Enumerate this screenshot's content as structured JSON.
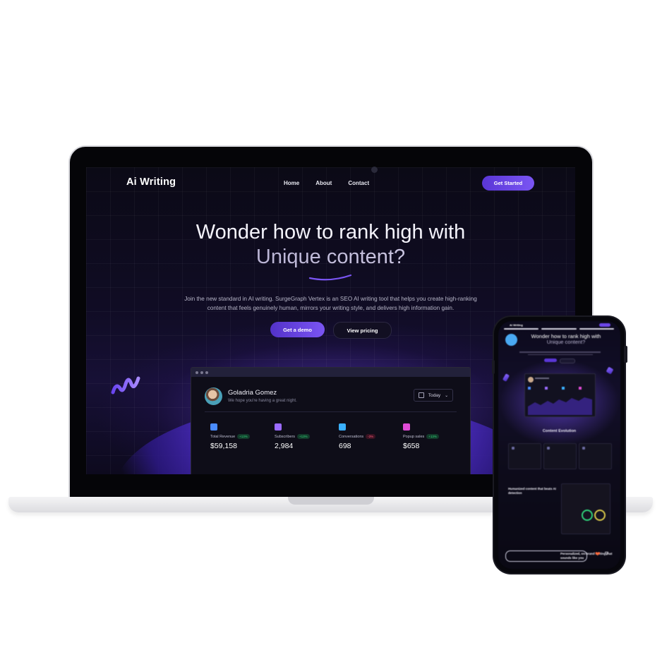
{
  "laptop": {
    "brand": "Ai Writing",
    "nav": [
      "Home",
      "About",
      "Contact"
    ],
    "cta_label": "Get Started",
    "headline_line1": "Wonder how to rank high with",
    "headline_line2": "Unique content?",
    "subtitle_line1": "Join the new standard in AI writing. SurgeGraph Vertex is an SEO AI writing tool that helps you create high-ranking",
    "subtitle_line2": "content that feels genuinely human, mirrors your writing style, and delivers high information gain.",
    "demo_label": "Get a demo",
    "pricing_label": "View pricing",
    "dashboard": {
      "user_name": "Goladria Gomez",
      "greeting": "We hope you're having a great night.",
      "period": "Today",
      "stats": [
        {
          "label": "Total Revenue",
          "change": "+13%",
          "value": "$59,158",
          "icon_color": "#4a8cff",
          "change_color": "#2fd27a"
        },
        {
          "label": "Subscribers",
          "change": "+13%",
          "value": "2,984",
          "icon_color": "#9b6bff",
          "change_color": "#2fd27a"
        },
        {
          "label": "Conversations",
          "change": "-3%",
          "value": "698",
          "icon_color": "#3ab0ff",
          "change_color": "#ff5a7a"
        },
        {
          "label": "Popup sales",
          "change": "+13%",
          "value": "$658",
          "icon_color": "#e04bd6",
          "change_color": "#2fd27a"
        }
      ]
    }
  },
  "phone": {
    "brand": "Ai Writing",
    "headline_line1": "Wonder how to rank high with",
    "headline_line2": "Unique content?",
    "section_title": "Content Evolution",
    "humanized_title": "Humanized content that beats AI detection",
    "personalized_title": "Personalized, on-brand writing that sounds like you"
  },
  "colors": {
    "accent": "#6b46e8",
    "background": "#0d0b1c"
  }
}
